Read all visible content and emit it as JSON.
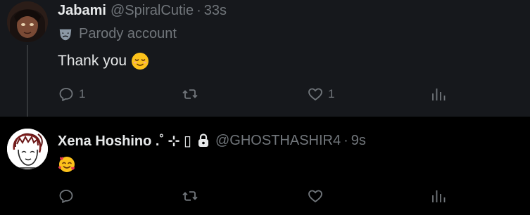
{
  "posts": [
    {
      "display_name": "Jabami",
      "handle": "@SpiralCutie",
      "separator": "·",
      "time": "33s",
      "parody_label": "Parody account",
      "text": "Thank you",
      "emoji": "relieved-face-emoji",
      "actions": {
        "reply_count": "1",
        "repost_count": "",
        "like_count": "1",
        "views_count": ""
      }
    },
    {
      "display_name": "Xena Hoshino .˚ ⊹ ▯",
      "handle": "@GHOSTHASHIR4",
      "separator": "·",
      "time": "9s",
      "text": "",
      "emoji": "smiling-face-with-hearts-emoji",
      "actions": {
        "reply_count": "",
        "repost_count": "",
        "like_count": "",
        "views_count": ""
      }
    }
  ],
  "colors": {
    "background": "#000000",
    "highlighted_post_background": "#16181c",
    "primary_text": "#e7e9ea",
    "secondary_text": "#71767b",
    "thread_line": "#333639"
  }
}
